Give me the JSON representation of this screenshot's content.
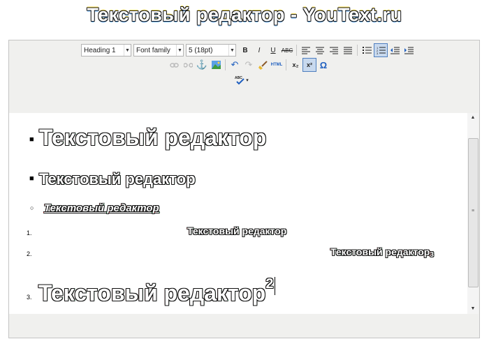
{
  "page": {
    "title": "Текстовый редактор - YouText.ru"
  },
  "toolbar": {
    "format_select": "Heading 1",
    "font_family_select": "Font family",
    "font_size_select": "5 (18pt)",
    "buttons": {
      "bold": "B",
      "italic": "I",
      "underline": "U",
      "strikethrough": "ABC",
      "html": "HTML",
      "subscript": "x₂",
      "superscript": "x²",
      "special_char": "Ω",
      "spellcheck": "ABC"
    }
  },
  "content": {
    "bulleted": [
      {
        "text": "Текстовый редактор"
      },
      {
        "text": "Текстовый редактор"
      },
      {
        "text": "Текстовый редактор"
      }
    ],
    "numbered": [
      {
        "num": "1.",
        "text": "Текстовый редактор"
      },
      {
        "num": "2.",
        "text": "Текстовый редактор",
        "suffix": "3"
      },
      {
        "num": "3.",
        "text": "Текстовый редактор",
        "suffix": "2"
      }
    ]
  },
  "colors": {
    "toolbar_bg": "#f0f0ee",
    "border": "#c4c4c4",
    "active_button": "#c8d9ee",
    "text_outline": "#111111"
  }
}
